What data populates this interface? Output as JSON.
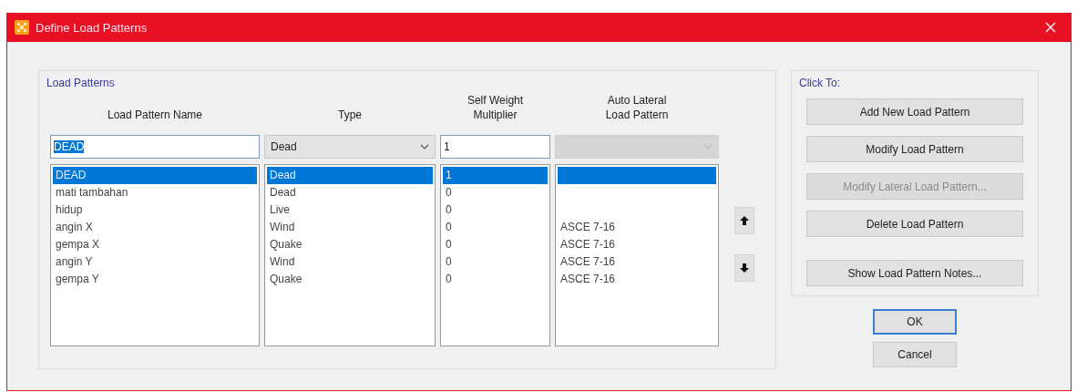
{
  "window": {
    "title": "Define Load Patterns"
  },
  "load_patterns": {
    "title": "Load Patterns",
    "columns": [
      "Load Pattern Name",
      "Type",
      "Self Weight Multiplier",
      "Auto Lateral Load Pattern"
    ],
    "edit_row": {
      "name": "DEAD",
      "type": "Dead",
      "multiplier": "1",
      "auto_lateral_disabled": true
    },
    "rows": [
      {
        "name": "DEAD",
        "type": "Dead",
        "multiplier": "1",
        "selected": true
      },
      {
        "name": "mati tambahan",
        "type": "Dead",
        "multiplier": "0",
        "selected": false
      },
      {
        "name": "hidup",
        "type": "Live",
        "multiplier": "0",
        "selected": false
      },
      {
        "name": "angin X",
        "type": "Wind",
        "multiplier": "0",
        "auto_lateral": "ASCE 7-16",
        "selected": false
      },
      {
        "name": "gempa X",
        "type": "Quake",
        "multiplier": "0",
        "auto_lateral": "ASCE 7-16",
        "selected": false
      },
      {
        "name": "angin Y",
        "type": "Wind",
        "multiplier": "0",
        "auto_lateral": "ASCE 7-16",
        "selected": false
      },
      {
        "name": "gempa Y",
        "type": "Quake",
        "multiplier": "0",
        "auto_lateral": "ASCE 7-16",
        "selected": false
      }
    ]
  },
  "click_to": {
    "title": "Click To:",
    "buttons": [
      {
        "label": "Add New Load Pattern",
        "disabled": false
      },
      {
        "label": "Modify Load Pattern",
        "disabled": false
      },
      {
        "label": "Modify Lateral Load Pattern...",
        "disabled": true
      },
      {
        "label": "Delete Load Pattern",
        "disabled": false
      },
      {
        "label": "Show Load Pattern Notes...",
        "disabled": false
      }
    ]
  },
  "dialog_buttons": [
    {
      "label": "OK",
      "default": true
    },
    {
      "label": "Cancel",
      "default": false
    }
  ]
}
